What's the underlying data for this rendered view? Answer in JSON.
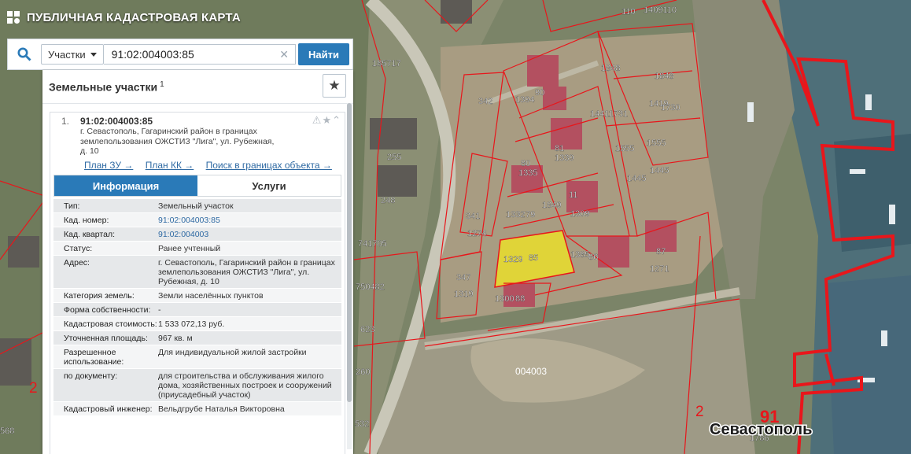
{
  "app": {
    "title": "ПУБЛИЧНАЯ КАДАСТРОВАЯ КАРТА"
  },
  "search": {
    "scope": "Участки",
    "query": "91:02:004003:85",
    "find_label": "Найти",
    "clear_glyph": "✕"
  },
  "panel": {
    "title": "Земельные участки",
    "count": "1",
    "result": {
      "number": "1.",
      "cad_number": "91:02:004003:85",
      "address_lines": [
        "г. Севастополь, Гагаринский район в границах",
        "землепользования ОЖСТИЗ \"Лига\", ул. Рубежная,",
        "д. 10"
      ],
      "links": [
        "План ЗУ →",
        "План КК →",
        "Поиск в границах объекта →"
      ],
      "tabs": [
        "Информация",
        "Услуги"
      ],
      "properties": [
        {
          "key": "Тип:",
          "value": "Земельный участок"
        },
        {
          "key": "Кад. номер:",
          "value": "91:02:004003:85"
        },
        {
          "key": "Кад. квартал:",
          "value": "91:02:004003"
        },
        {
          "key": "Статус:",
          "value": "Ранее учтенный"
        },
        {
          "key": "Адрес:",
          "value": "г. Севастополь, Гагаринский район в границах землепользования ОЖСТИЗ \"Лига\", ул. Рубежная, д. 10"
        },
        {
          "key": "Категория земель:",
          "value": "Земли населённых пунктов"
        },
        {
          "key": "Форма собственности:",
          "value": "-"
        },
        {
          "key": "Кадастровая стоимость:",
          "value": "1 533 072,13 руб."
        },
        {
          "key": "Уточненная площадь:",
          "value": "967 кв. м"
        },
        {
          "key": "Разрешенное использование:",
          "value": "Для индивидуальной жилой застройки"
        },
        {
          "key": "по документу:",
          "value": "для строительства и обслуживания жилого дома, хозяйственных построек и сооружений (приусадебный участок)"
        },
        {
          "key": "Кадастровый инженер:",
          "value": "Вельдгрубе Наталья Викторовна"
        }
      ]
    }
  },
  "map": {
    "city_label": "Севастополь",
    "region_number": "91",
    "quarter_number": "2",
    "quarter_label": "004003",
    "parcel_labels": [
      "110",
      "1409110",
      "185717",
      "1848",
      "1848",
      "1394",
      "90",
      "342",
      "14411731",
      "1419",
      "1730",
      "1555",
      "1555",
      "81",
      "1339",
      "255",
      "80",
      "1335",
      "1445",
      "1445",
      "248",
      "1849",
      "11",
      "1332",
      "79",
      "1309",
      "341",
      "1274",
      "741705",
      "87",
      "1271",
      "1329",
      "85",
      "1385",
      "86",
      "347",
      "1319",
      "750482",
      "1300",
      "88",
      "623",
      "260",
      "532",
      "568",
      "1786",
      "2"
    ],
    "colors": {
      "boundary": "#e8161b",
      "selected": "#f3e71f",
      "label_text": "#ffffff"
    }
  }
}
